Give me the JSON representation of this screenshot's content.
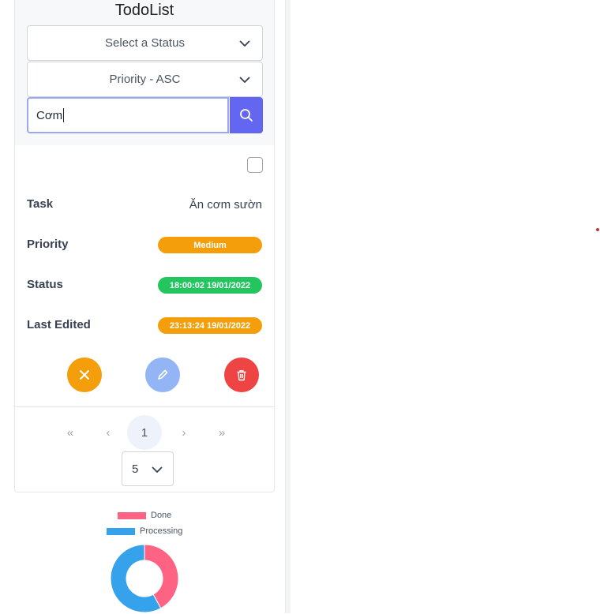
{
  "app": {
    "title": "TodoList"
  },
  "filters": {
    "status_select": "Select a Status",
    "sort_select": "Priority - ASC",
    "search_value": "Cơm"
  },
  "todo": {
    "task_label": "Task",
    "task_value": "Ăn cơm sườn",
    "priority_label": "Priority",
    "priority_value": "Medium",
    "status_label": "Status",
    "status_value": "18:00:02 19/01/2022",
    "edited_label": "Last Edited",
    "edited_value": "23:13:24 19/01/2022"
  },
  "pagination": {
    "first": "«",
    "prev": "‹",
    "current": "1",
    "next": "›",
    "last": "»",
    "page_size": "5"
  },
  "chart_data": {
    "type": "pie",
    "labels": [
      "Done",
      "Processing"
    ],
    "values": [
      42,
      58
    ],
    "colors": [
      "#ff6384",
      "#36a2eb"
    ],
    "legend": "top",
    "title": ""
  },
  "colors": {
    "accent": "#6366f1",
    "warning": "#f59e0b",
    "success": "#22c55e",
    "danger": "#ef4444"
  },
  "icons": {
    "search": "search-icon",
    "cancel": "close-icon",
    "edit": "pencil-icon",
    "delete": "trash-icon",
    "chevron": "chevron-down-icon"
  }
}
